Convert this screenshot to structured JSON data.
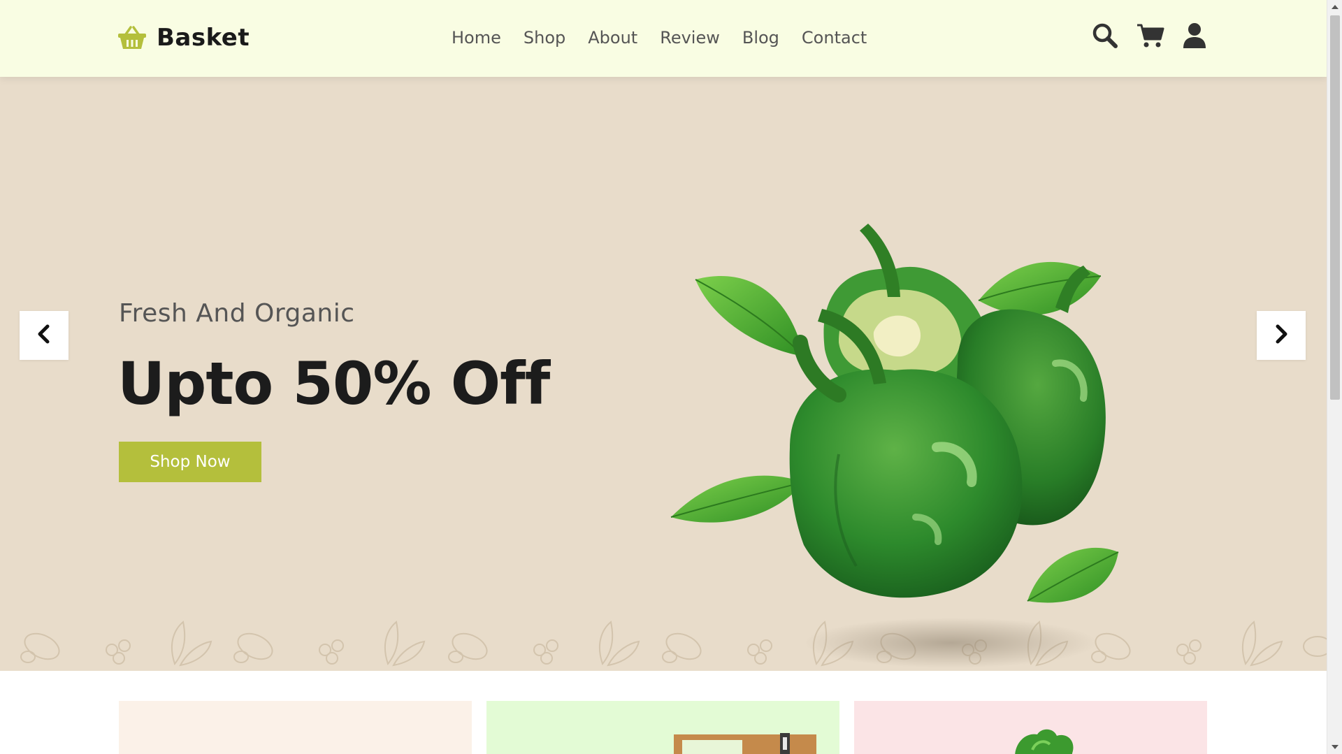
{
  "app": {
    "brand": "Basket",
    "accent_color": "#b4bf3c",
    "header_bg": "#f9fde3",
    "hero_bg": "#e8dcca"
  },
  "nav": {
    "items": [
      "Home",
      "Shop",
      "About",
      "Review",
      "Blog",
      "Contact"
    ]
  },
  "header_icons": [
    "search-icon",
    "cart-icon",
    "user-icon"
  ],
  "hero": {
    "subtitle": "Fresh And Organic",
    "title": "Upto 50% Off",
    "cta_label": "Shop Now",
    "image": "green-bell-peppers-image",
    "prev_icon": "chevron-left-icon",
    "next_icon": "chevron-right-icon"
  },
  "cards": [
    {
      "bg": "#fbf1e8"
    },
    {
      "bg": "#e3fbd5"
    },
    {
      "bg": "#fbe4e6"
    }
  ]
}
